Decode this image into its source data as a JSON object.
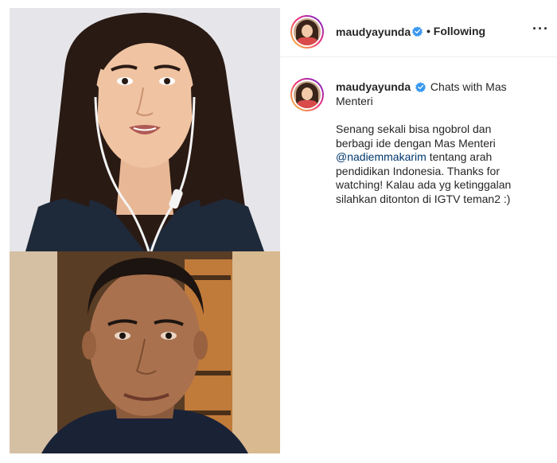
{
  "post": {
    "username": "maudyayunda",
    "follow_state": "• Following",
    "more_label": "···",
    "caption": {
      "username": "maudyayunda",
      "title": "Chats with Mas Menteri",
      "body_part1": "Senang sekali bisa ngobrol dan berbagi ide dengan Mas Menteri ",
      "mention": "@nadiemmakarim",
      "body_part2": " tentang arah pendidikan Indonesia. Thanks for watching! Kalau ada yg ketinggalan silahkan ditonton di IGTV teman2 :)"
    }
  },
  "icons": {
    "verified": "verified-badge-icon",
    "more": "more-options-icon"
  },
  "colors": {
    "verified_blue": "#3897f0",
    "mention_blue": "#00376b",
    "text": "#262626"
  }
}
